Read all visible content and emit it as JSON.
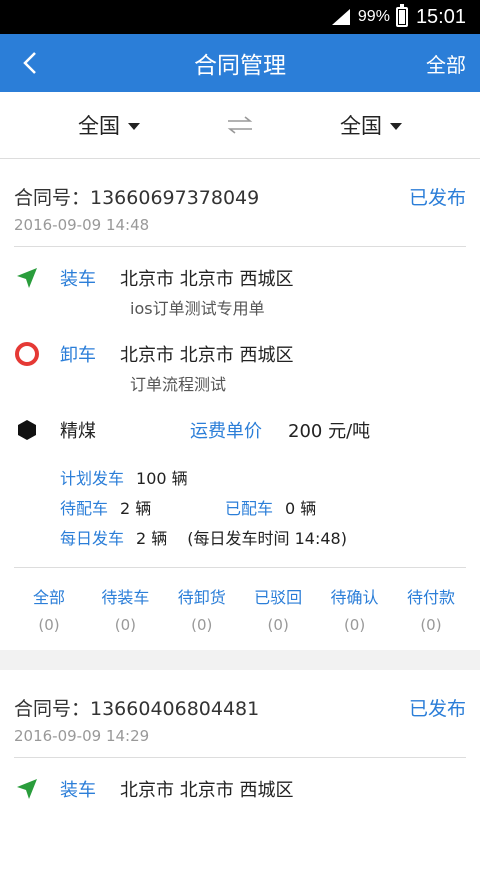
{
  "statusbar": {
    "battery": "99%",
    "time": "15:01"
  },
  "nav": {
    "title": "合同管理",
    "right": "全部"
  },
  "filter": {
    "from": "全国",
    "to": "全国"
  },
  "cards": [
    {
      "contract_label": "合同号：13660697378049",
      "status": "已发布",
      "date": "2016-09-09 14:48",
      "load": {
        "label": "装车",
        "address": "北京市 北京市 西城区",
        "note": "ios订单测试专用单"
      },
      "unload": {
        "label": "卸车",
        "address": "北京市 北京市 西城区",
        "note": "订单流程测试"
      },
      "goods": "精煤",
      "freight_label": "运费单价",
      "freight_value": "200 元/吨",
      "plan_label": "计划发车",
      "plan_value": "100 辆",
      "pending_label": "待配车",
      "pending_value": "2 辆",
      "assigned_label": "已配车",
      "assigned_value": "0 辆",
      "daily_label": "每日发车",
      "daily_value": "2 辆",
      "daily_time": "(每日发车时间 14:48)",
      "stats": [
        {
          "label": "全部",
          "value": "(0)"
        },
        {
          "label": "待装车",
          "value": "(0)"
        },
        {
          "label": "待卸货",
          "value": "(0)"
        },
        {
          "label": "已驳回",
          "value": "(0)"
        },
        {
          "label": "待确认",
          "value": "(0)"
        },
        {
          "label": "待付款",
          "value": "(0)"
        }
      ]
    },
    {
      "contract_label": "合同号：13660406804481",
      "status": "已发布",
      "date": "2016-09-09 14:29",
      "load": {
        "label": "装车",
        "address": "北京市 北京市 西城区"
      }
    }
  ],
  "colors": {
    "accent": "#2b7ed8",
    "load_icon": "#2a9d3c",
    "unload_icon": "#e53935"
  }
}
